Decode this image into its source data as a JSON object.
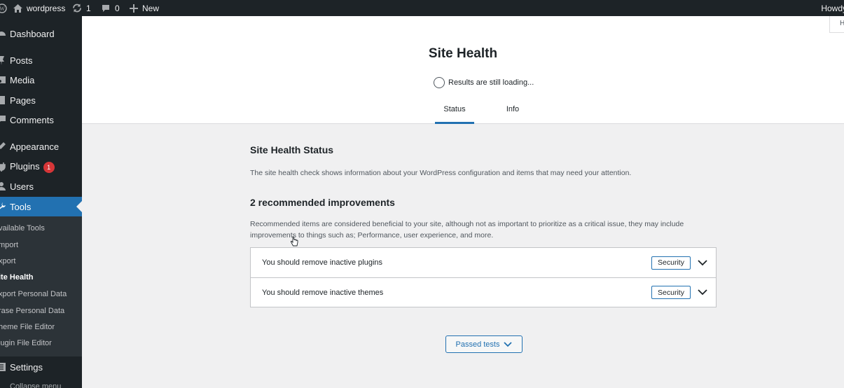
{
  "admin_bar": {
    "site_name": "wordpress",
    "updates_count": "1",
    "comments_count": "0",
    "new_label": "New",
    "howdy": "Howdy"
  },
  "sidebar": {
    "items": [
      {
        "label": "Dashboard",
        "icon": "dashboard-icon"
      },
      {
        "label": "Posts",
        "icon": "pin-icon"
      },
      {
        "label": "Media",
        "icon": "media-icon"
      },
      {
        "label": "Pages",
        "icon": "page-icon"
      },
      {
        "label": "Comments",
        "icon": "comment-icon"
      },
      {
        "label": "Appearance",
        "icon": "brush-icon"
      },
      {
        "label": "Plugins",
        "icon": "plugin-icon",
        "badge": "1"
      },
      {
        "label": "Users",
        "icon": "user-icon"
      },
      {
        "label": "Tools",
        "icon": "wrench-icon"
      },
      {
        "label": "Settings",
        "icon": "settings-icon"
      }
    ],
    "submenu": [
      "vailable Tools",
      "mport",
      "xport",
      "ite Health",
      "xport Personal Data",
      "rase Personal Data",
      "heme File Editor",
      "lugin File Editor"
    ],
    "collapse_label": "Collapse menu"
  },
  "header": {
    "title": "Site Health",
    "loading_text": "Results are still loading...",
    "tabs": [
      "Status",
      "Info"
    ],
    "help_label": "H"
  },
  "main": {
    "status_heading": "Site Health Status",
    "status_desc": "The site health check shows information about your WordPress configuration and items that may need your attention.",
    "improvements_heading": "2 recommended improvements",
    "improvements_desc": "Recommended items are considered beneficial to your site, although not as important to prioritize as a critical issue, they may include improvements to things such as; Performance, user experience, and more.",
    "issues": [
      {
        "title": "You should remove inactive plugins",
        "badge": "Security"
      },
      {
        "title": "You should remove inactive themes",
        "badge": "Security"
      }
    ],
    "passed_tests_label": "Passed tests"
  },
  "colors": {
    "admin_dark": "#1d2327",
    "accent": "#2271b1",
    "badge_red": "#d63638"
  }
}
